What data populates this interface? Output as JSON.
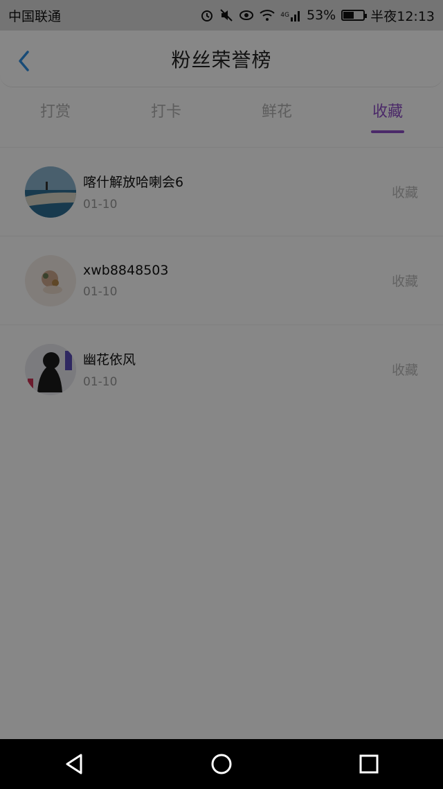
{
  "status_bar": {
    "carrier": "中国联通",
    "signal_label": "4G",
    "battery": "53%",
    "battery_level": 0.53,
    "time": "半夜12:13"
  },
  "header": {
    "title": "粉丝荣誉榜"
  },
  "tabs": [
    {
      "label": "打赏",
      "active": false
    },
    {
      "label": "打卡",
      "active": false
    },
    {
      "label": "鲜花",
      "active": false
    },
    {
      "label": "收藏",
      "active": true
    }
  ],
  "list": [
    {
      "name": "喀什解放哈喇会6",
      "date": "01-10",
      "action": "收藏"
    },
    {
      "name": "xwb8848503",
      "date": "01-10",
      "action": "收藏"
    },
    {
      "name": "幽花依风",
      "date": "01-10",
      "action": "收藏"
    }
  ],
  "colors": {
    "accent": "#8e4ec6",
    "back_arrow": "#2f8fe0",
    "overlay": "rgba(0,0,0,0.47)"
  }
}
